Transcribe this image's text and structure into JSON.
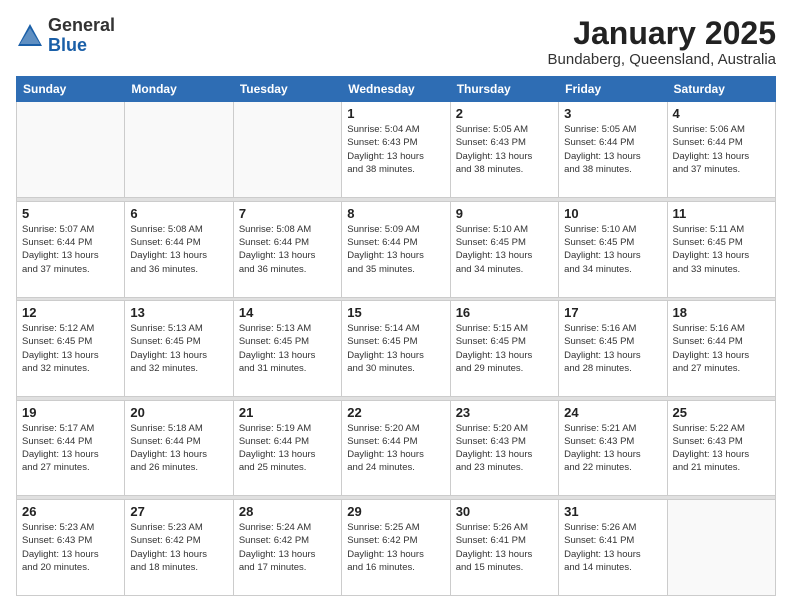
{
  "logo": {
    "general": "General",
    "blue": "Blue"
  },
  "title": "January 2025",
  "location": "Bundaberg, Queensland, Australia",
  "weekdays": [
    "Sunday",
    "Monday",
    "Tuesday",
    "Wednesday",
    "Thursday",
    "Friday",
    "Saturday"
  ],
  "weeks": [
    [
      {
        "day": "",
        "info": ""
      },
      {
        "day": "",
        "info": ""
      },
      {
        "day": "",
        "info": ""
      },
      {
        "day": "1",
        "info": "Sunrise: 5:04 AM\nSunset: 6:43 PM\nDaylight: 13 hours\nand 38 minutes."
      },
      {
        "day": "2",
        "info": "Sunrise: 5:05 AM\nSunset: 6:43 PM\nDaylight: 13 hours\nand 38 minutes."
      },
      {
        "day": "3",
        "info": "Sunrise: 5:05 AM\nSunset: 6:44 PM\nDaylight: 13 hours\nand 38 minutes."
      },
      {
        "day": "4",
        "info": "Sunrise: 5:06 AM\nSunset: 6:44 PM\nDaylight: 13 hours\nand 37 minutes."
      }
    ],
    [
      {
        "day": "5",
        "info": "Sunrise: 5:07 AM\nSunset: 6:44 PM\nDaylight: 13 hours\nand 37 minutes."
      },
      {
        "day": "6",
        "info": "Sunrise: 5:08 AM\nSunset: 6:44 PM\nDaylight: 13 hours\nand 36 minutes."
      },
      {
        "day": "7",
        "info": "Sunrise: 5:08 AM\nSunset: 6:44 PM\nDaylight: 13 hours\nand 36 minutes."
      },
      {
        "day": "8",
        "info": "Sunrise: 5:09 AM\nSunset: 6:44 PM\nDaylight: 13 hours\nand 35 minutes."
      },
      {
        "day": "9",
        "info": "Sunrise: 5:10 AM\nSunset: 6:45 PM\nDaylight: 13 hours\nand 34 minutes."
      },
      {
        "day": "10",
        "info": "Sunrise: 5:10 AM\nSunset: 6:45 PM\nDaylight: 13 hours\nand 34 minutes."
      },
      {
        "day": "11",
        "info": "Sunrise: 5:11 AM\nSunset: 6:45 PM\nDaylight: 13 hours\nand 33 minutes."
      }
    ],
    [
      {
        "day": "12",
        "info": "Sunrise: 5:12 AM\nSunset: 6:45 PM\nDaylight: 13 hours\nand 32 minutes."
      },
      {
        "day": "13",
        "info": "Sunrise: 5:13 AM\nSunset: 6:45 PM\nDaylight: 13 hours\nand 32 minutes."
      },
      {
        "day": "14",
        "info": "Sunrise: 5:13 AM\nSunset: 6:45 PM\nDaylight: 13 hours\nand 31 minutes."
      },
      {
        "day": "15",
        "info": "Sunrise: 5:14 AM\nSunset: 6:45 PM\nDaylight: 13 hours\nand 30 minutes."
      },
      {
        "day": "16",
        "info": "Sunrise: 5:15 AM\nSunset: 6:45 PM\nDaylight: 13 hours\nand 29 minutes."
      },
      {
        "day": "17",
        "info": "Sunrise: 5:16 AM\nSunset: 6:45 PM\nDaylight: 13 hours\nand 28 minutes."
      },
      {
        "day": "18",
        "info": "Sunrise: 5:16 AM\nSunset: 6:44 PM\nDaylight: 13 hours\nand 27 minutes."
      }
    ],
    [
      {
        "day": "19",
        "info": "Sunrise: 5:17 AM\nSunset: 6:44 PM\nDaylight: 13 hours\nand 27 minutes."
      },
      {
        "day": "20",
        "info": "Sunrise: 5:18 AM\nSunset: 6:44 PM\nDaylight: 13 hours\nand 26 minutes."
      },
      {
        "day": "21",
        "info": "Sunrise: 5:19 AM\nSunset: 6:44 PM\nDaylight: 13 hours\nand 25 minutes."
      },
      {
        "day": "22",
        "info": "Sunrise: 5:20 AM\nSunset: 6:44 PM\nDaylight: 13 hours\nand 24 minutes."
      },
      {
        "day": "23",
        "info": "Sunrise: 5:20 AM\nSunset: 6:43 PM\nDaylight: 13 hours\nand 23 minutes."
      },
      {
        "day": "24",
        "info": "Sunrise: 5:21 AM\nSunset: 6:43 PM\nDaylight: 13 hours\nand 22 minutes."
      },
      {
        "day": "25",
        "info": "Sunrise: 5:22 AM\nSunset: 6:43 PM\nDaylight: 13 hours\nand 21 minutes."
      }
    ],
    [
      {
        "day": "26",
        "info": "Sunrise: 5:23 AM\nSunset: 6:43 PM\nDaylight: 13 hours\nand 20 minutes."
      },
      {
        "day": "27",
        "info": "Sunrise: 5:23 AM\nSunset: 6:42 PM\nDaylight: 13 hours\nand 18 minutes."
      },
      {
        "day": "28",
        "info": "Sunrise: 5:24 AM\nSunset: 6:42 PM\nDaylight: 13 hours\nand 17 minutes."
      },
      {
        "day": "29",
        "info": "Sunrise: 5:25 AM\nSunset: 6:42 PM\nDaylight: 13 hours\nand 16 minutes."
      },
      {
        "day": "30",
        "info": "Sunrise: 5:26 AM\nSunset: 6:41 PM\nDaylight: 13 hours\nand 15 minutes."
      },
      {
        "day": "31",
        "info": "Sunrise: 5:26 AM\nSunset: 6:41 PM\nDaylight: 13 hours\nand 14 minutes."
      },
      {
        "day": "",
        "info": ""
      }
    ]
  ]
}
